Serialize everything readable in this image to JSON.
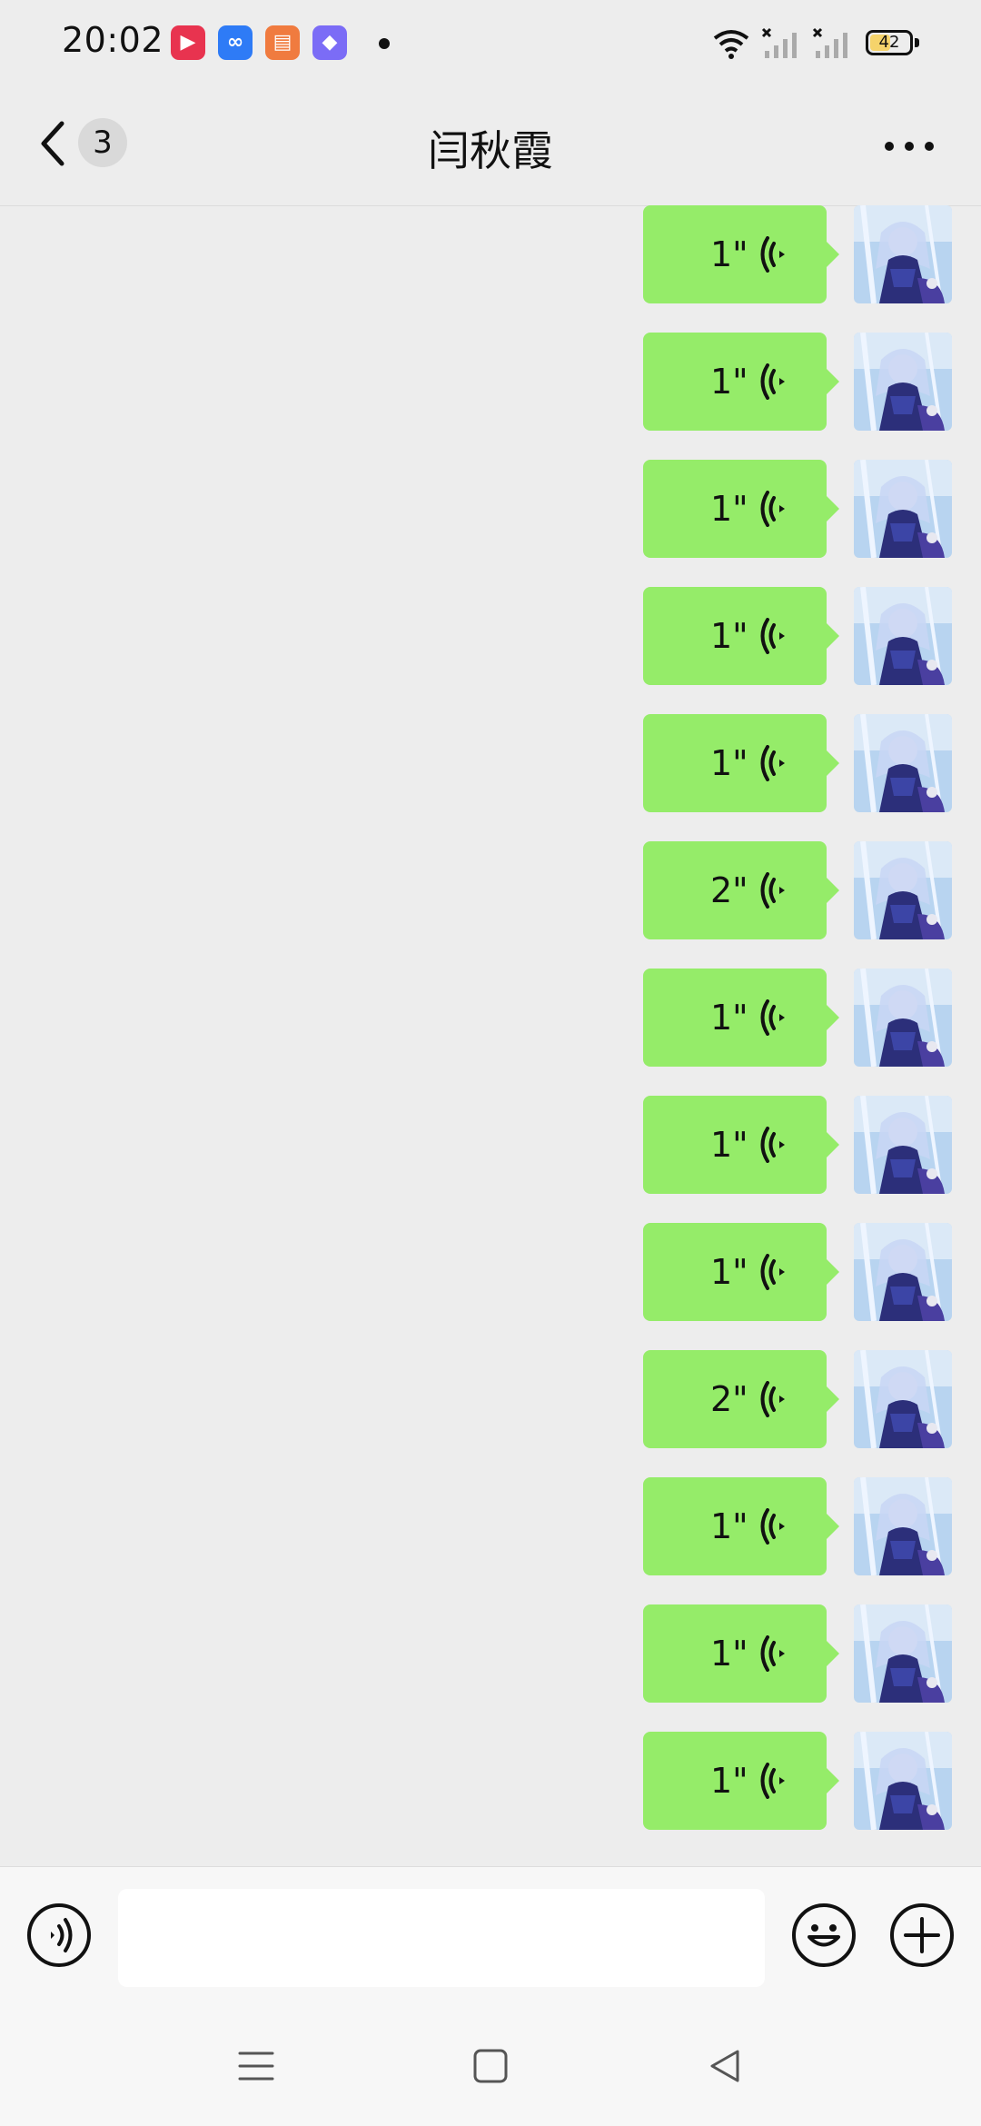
{
  "status_bar": {
    "time": "20:02",
    "battery_level": "42",
    "app_icons": [
      {
        "name": "video-app-icon",
        "color": "#e8334f",
        "glyph": "▶"
      },
      {
        "name": "cloud-app-icon",
        "color": "#2e7bf6",
        "glyph": "∞"
      },
      {
        "name": "book-app-icon",
        "color": "#f07b3f",
        "glyph": "▤"
      },
      {
        "name": "shortcut-app-icon",
        "color": "#7b6cf6",
        "glyph": "◆"
      }
    ]
  },
  "header": {
    "unread_count": "3",
    "title": "闫秋霞"
  },
  "messages": [
    {
      "duration": "1\""
    },
    {
      "duration": "1\""
    },
    {
      "duration": "1\""
    },
    {
      "duration": "1\""
    },
    {
      "duration": "1\""
    },
    {
      "duration": "2\""
    },
    {
      "duration": "1\""
    },
    {
      "duration": "1\""
    },
    {
      "duration": "1\""
    },
    {
      "duration": "2\""
    },
    {
      "duration": "1\""
    },
    {
      "duration": "1\""
    },
    {
      "duration": "1\""
    }
  ],
  "input": {
    "value": "",
    "placeholder": ""
  },
  "colors": {
    "bubble": "#95ec69",
    "background": "#ededed"
  }
}
